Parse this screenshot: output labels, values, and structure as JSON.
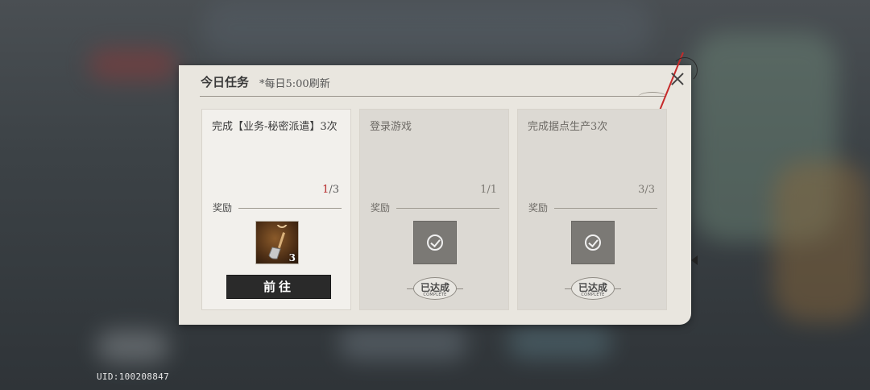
{
  "dialog": {
    "title": "今日任务",
    "note": "*每日5:00刷新"
  },
  "tasks": [
    {
      "name": "完成【业务-秘密派遣】3次",
      "progress_current": "1",
      "progress_total": "/3",
      "reward_label": "奖励",
      "reward_item": {
        "icon": "shovel-icon",
        "quantity": "3"
      },
      "action_label": "前往",
      "completed": false
    },
    {
      "name": "登录游戏",
      "progress": "1/1",
      "reward_label": "奖励",
      "stamp_text": "已达成",
      "stamp_sub": "COMPLETE",
      "completed": true
    },
    {
      "name": "完成据点生产3次",
      "progress": "3/3",
      "reward_label": "奖励",
      "stamp_text": "已达成",
      "stamp_sub": "COMPLETE",
      "completed": true
    }
  ],
  "uid": "UID:100208847",
  "colors": {
    "accent_red": "#b52525",
    "button_dark": "#2a2a2a"
  }
}
